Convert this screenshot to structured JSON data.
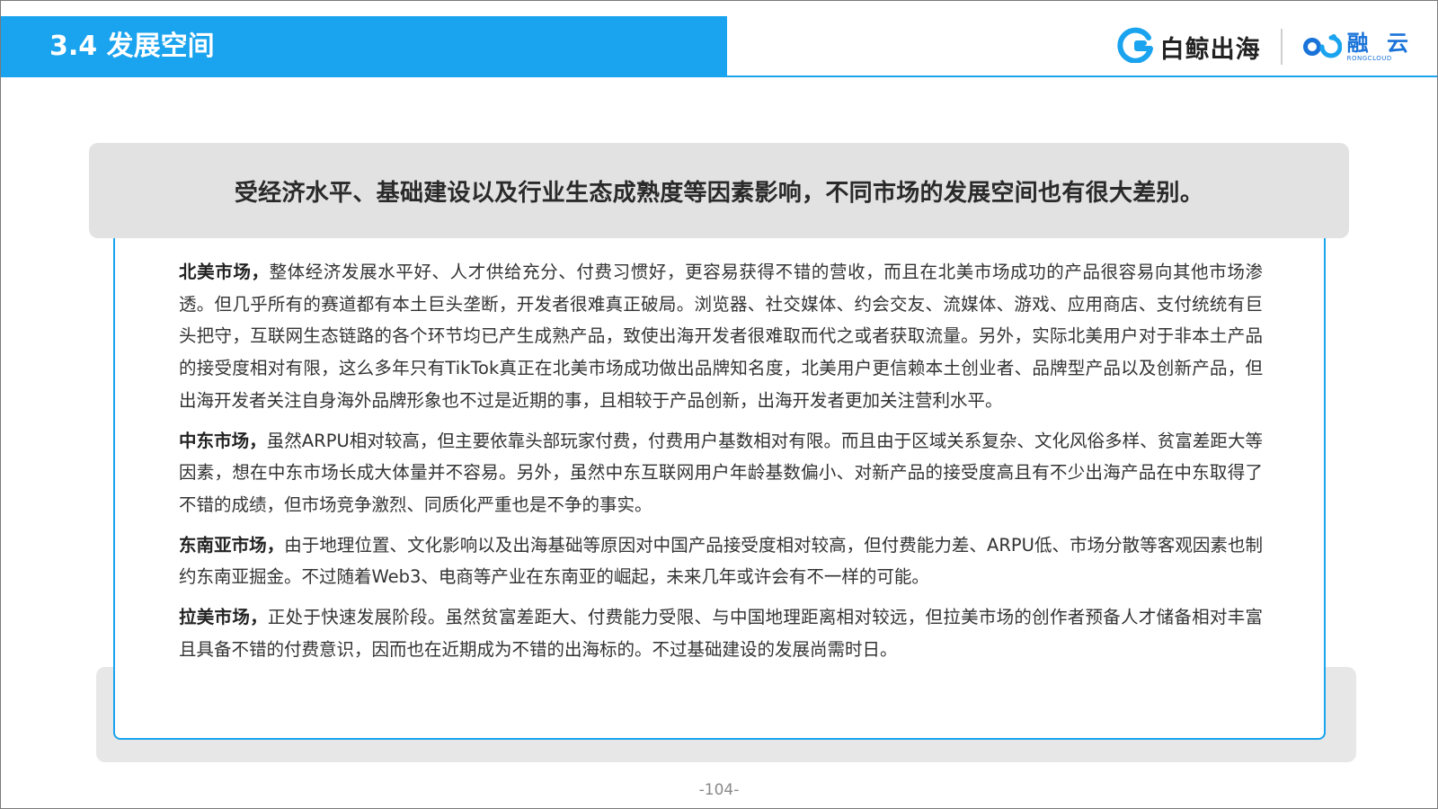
{
  "header": {
    "title": "3.4 发展空间",
    "logo1_text": "白鲸出海",
    "logo2_cn": "融 云",
    "logo2_en": "RONGCLOUD"
  },
  "summary": "受经济水平、基础建设以及行业生态成熟度等因素影响，不同市场的发展空间也有很大差别。",
  "paragraphs": [
    {
      "lead": "北美市场，",
      "body": "整体经济发展水平好、人才供给充分、付费习惯好，更容易获得不错的营收，而且在北美市场成功的产品很容易向其他市场渗透。但几乎所有的赛道都有本土巨头垄断，开发者很难真正破局。浏览器、社交媒体、约会交友、流媒体、游戏、应用商店、支付统统有巨头把守，互联网生态链路的各个环节均已产生成熟产品，致使出海开发者很难取而代之或者获取流量。另外，实际北美用户对于非本土产品的接受度相对有限，这么多年只有TikTok真正在北美市场成功做出品牌知名度，北美用户更信赖本土创业者、品牌型产品以及创新产品，但出海开发者关注自身海外品牌形象也不过是近期的事，且相较于产品创新，出海开发者更加关注营利水平。"
    },
    {
      "lead": "中东市场，",
      "body": "虽然ARPU相对较高，但主要依靠头部玩家付费，付费用户基数相对有限。而且由于区域关系复杂、文化风俗多样、贫富差距大等因素，想在中东市场长成大体量并不容易。另外，虽然中东互联网用户年龄基数偏小、对新产品的接受度高且有不少出海产品在中东取得了不错的成绩，但市场竞争激烈、同质化严重也是不争的事实。"
    },
    {
      "lead": "东南亚市场，",
      "body": "由于地理位置、文化影响以及出海基础等原因对中国产品接受度相对较高，但付费能力差、ARPU低、市场分散等客观因素也制约东南亚掘金。不过随着Web3、电商等产业在东南亚的崛起，未来几年或许会有不一样的可能。"
    },
    {
      "lead": "拉美市场，",
      "body": "正处于快速发展阶段。虽然贫富差距大、付费能力受限、与中国地理距离相对较远，但拉美市场的创作者预备人才储备相对丰富且具备不错的付费意识，因而也在近期成为不错的出海标的。不过基础建设的发展尚需时日。"
    }
  ],
  "page_number": "-104-",
  "colors": {
    "accent": "#1aa3ee",
    "logo_blue": "#1a73d9",
    "panel_gray": "#e2e2e2"
  },
  "icons": [
    "whale-logo-icon",
    "rongcloud-logo-icon"
  ]
}
